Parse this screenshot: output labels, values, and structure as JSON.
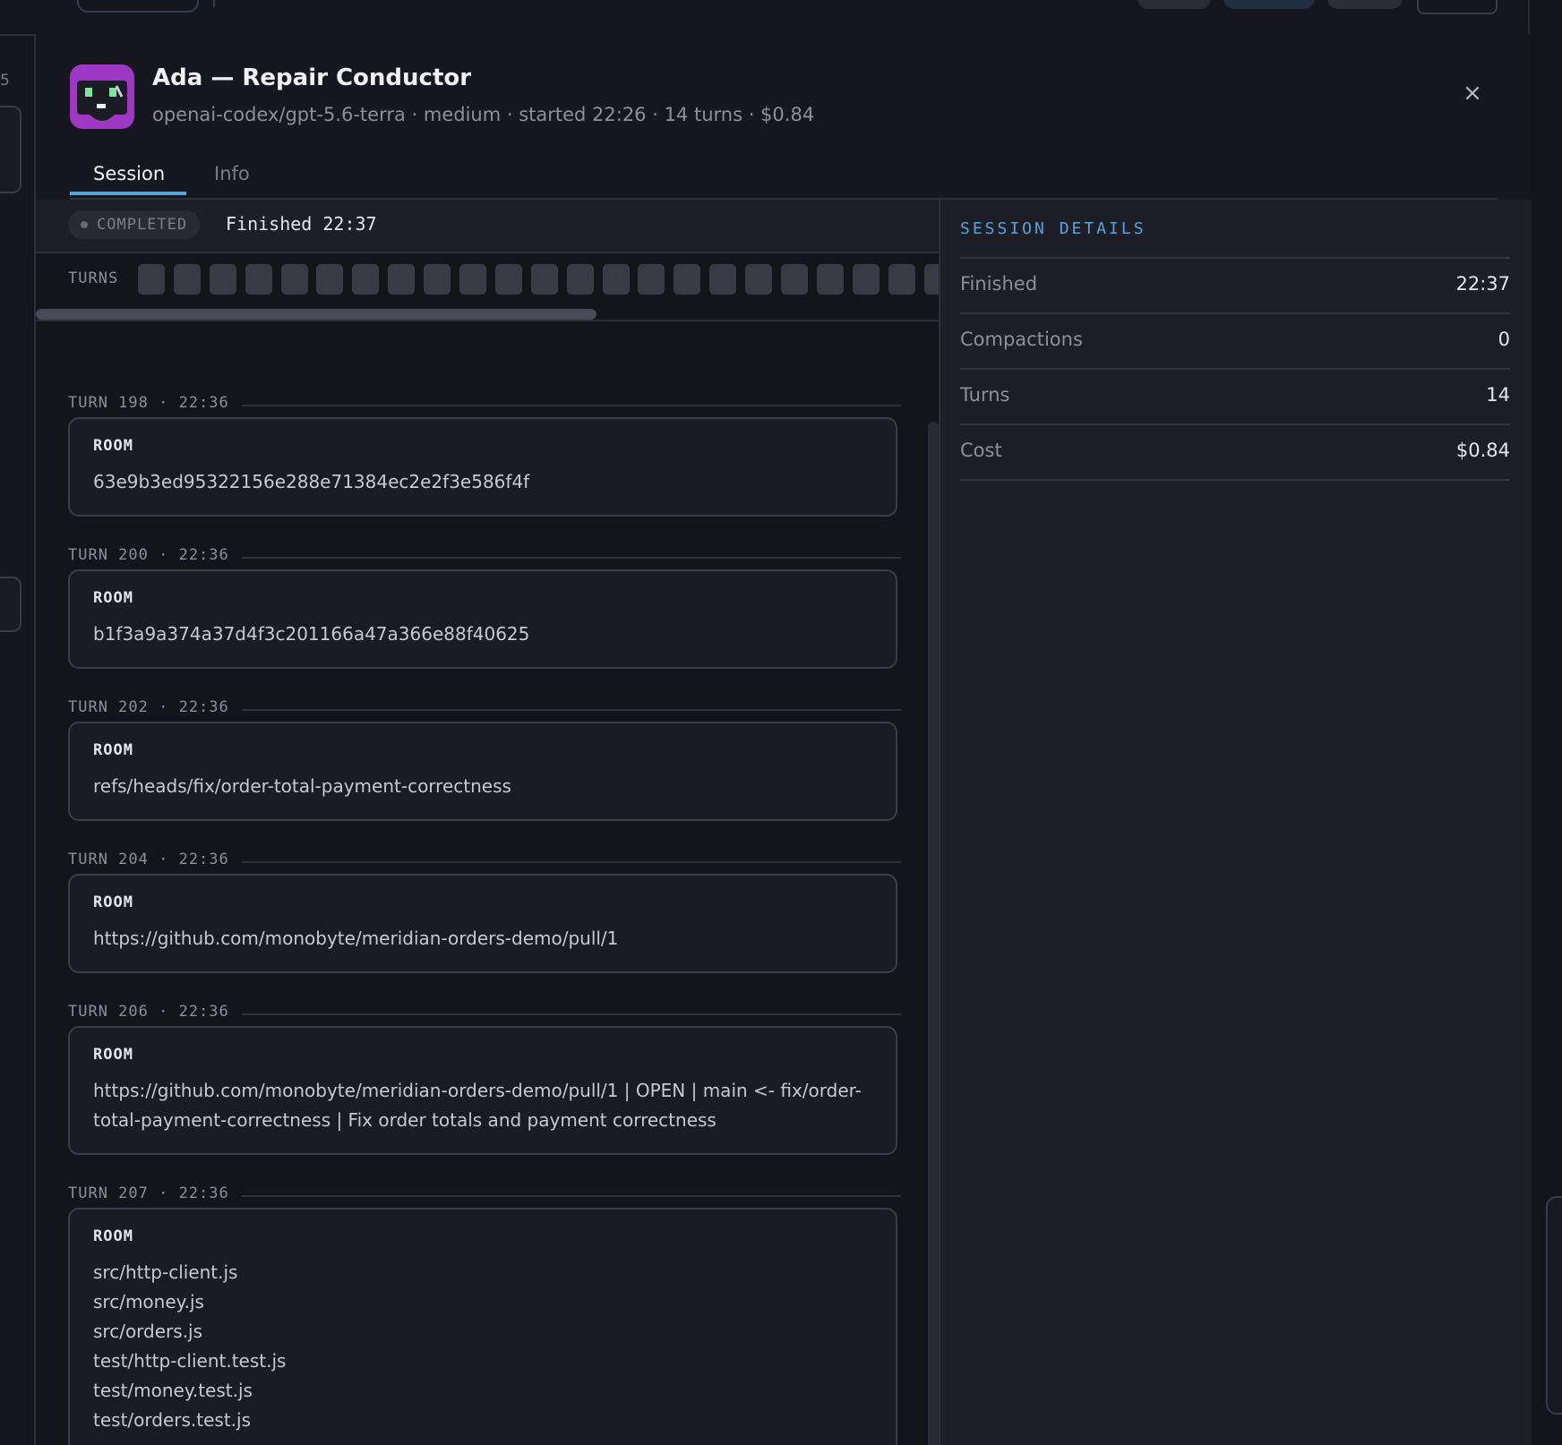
{
  "left_edge": {
    "partial_number": "5"
  },
  "header": {
    "title": "Ada — Repair Conductor",
    "subtitle": "openai-codex/gpt-5.6-terra · medium · started 22:26 · 14 turns · $0.84",
    "close_icon": "close-icon",
    "avatar_icon": "robot-avatar-icon",
    "avatar_color": "#9e38c4"
  },
  "tabs": [
    {
      "label": "Session",
      "active": true
    },
    {
      "label": "Info",
      "active": false
    }
  ],
  "status": {
    "badge": "COMPLETED",
    "finished_text": "Finished 22:37"
  },
  "turns_strip": {
    "label": "TURNS",
    "visible_count": 23
  },
  "turns": [
    {
      "header": "TURN 198 · 22:36",
      "card_label": "ROOM",
      "lines": [
        "63e9b3ed95322156e288e71384ec2e2f3e586f4f"
      ]
    },
    {
      "header": "TURN 200 · 22:36",
      "card_label": "ROOM",
      "lines": [
        "b1f3a9a374a37d4f3c201166a47a366e88f40625"
      ]
    },
    {
      "header": "TURN 202 · 22:36",
      "card_label": "ROOM",
      "lines": [
        "refs/heads/fix/order-total-payment-correctness"
      ]
    },
    {
      "header": "TURN 204 · 22:36",
      "card_label": "ROOM",
      "lines": [
        "https://github.com/monobyte/meridian-orders-demo/pull/1"
      ]
    },
    {
      "header": "TURN 206 · 22:36",
      "card_label": "ROOM",
      "lines": [
        "https://github.com/monobyte/meridian-orders-demo/pull/1 | OPEN | main <- fix/order-",
        "total-payment-correctness | Fix order totals and payment correctness"
      ]
    },
    {
      "header": "TURN 207 · 22:36",
      "card_label": "ROOM",
      "lines": [
        "src/http-client.js",
        "src/money.js",
        "src/orders.js",
        "test/http-client.test.js",
        "test/money.test.js",
        "test/orders.test.js"
      ]
    }
  ],
  "details": {
    "title": "SESSION DETAILS",
    "rows": [
      {
        "label": "Finished",
        "value": "22:37"
      },
      {
        "label": "Compactions",
        "value": "0"
      },
      {
        "label": "Turns",
        "value": "14"
      },
      {
        "label": "Cost",
        "value": "$0.84"
      }
    ]
  },
  "colors": {
    "accent": "#5aa3d9",
    "background": "#16161e",
    "status_badge_bg": "#2a2a34"
  }
}
